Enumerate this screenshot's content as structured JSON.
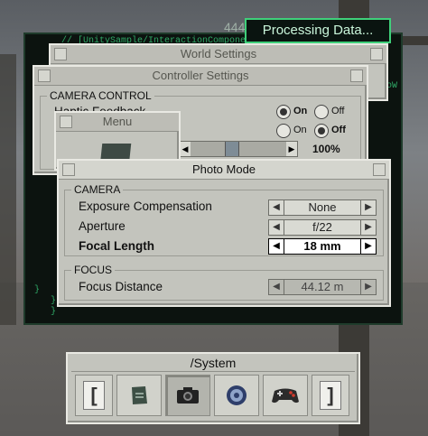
{
  "status": {
    "processing": "Processing Data..."
  },
  "console": {
    "top_text": "444",
    "top_line": "// [UnitySample/InteractionComponent].",
    "right_text": "oW",
    "close_brace": "}"
  },
  "world_settings": {
    "title": "World Settings"
  },
  "controller_settings": {
    "title": "Controller Settings",
    "section": "CAMERA CONTROL",
    "haptic_label": "Haptic Feedback",
    "row1": {
      "on": "On",
      "off": "Off",
      "selected": "on"
    },
    "row2": {
      "on": "On",
      "off": "Off",
      "selected": "off"
    },
    "slider_value": "100%"
  },
  "menu": {
    "title": "Menu"
  },
  "photo_mode": {
    "title": "Photo Mode",
    "camera_section": "CAMERA",
    "focus_section": "FOCUS",
    "rows": [
      {
        "label": "Exposure Compensation",
        "value": "None"
      },
      {
        "label": "Aperture",
        "value": "f/22"
      },
      {
        "label": "Focal Length",
        "value": "18 mm"
      },
      {
        "label": "Focus Distance",
        "value": "44.12 m"
      }
    ]
  },
  "taskbar": {
    "title": "/System",
    "left_bracket": "[",
    "right_bracket": "]",
    "icons": [
      "notes-icon",
      "camera-icon",
      "settings-gear-icon",
      "gamepad-icon"
    ]
  },
  "colors": {
    "console_green": "#3fd07a",
    "panel": "#c3c4bd",
    "gamepad_red": "#d23a2d"
  }
}
